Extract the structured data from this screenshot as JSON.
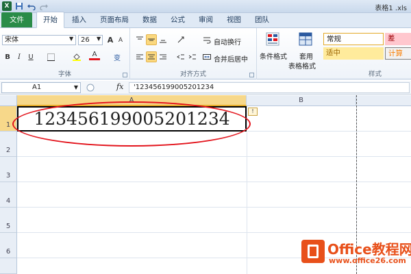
{
  "titlebar": {
    "doc_title": "表格1 .xls",
    "icons": [
      "excel-logo-icon",
      "save-icon",
      "undo-icon",
      "redo-icon"
    ]
  },
  "tabs": [
    "文件",
    "开始",
    "插入",
    "页面布局",
    "数据",
    "公式",
    "审阅",
    "视图",
    "团队"
  ],
  "ribbon": {
    "font": {
      "name": "宋体",
      "size": "26",
      "grow": "A",
      "shrink": "A",
      "bold": "B",
      "italic": "I",
      "underline": "U",
      "font_color": "A",
      "phonetic": "变",
      "label": "字体"
    },
    "alignment": {
      "wrap_text": "自动换行",
      "merge_center": "合并后居中",
      "label": "对齐方式"
    },
    "styles": {
      "conditional_format": "条件格式",
      "table_format_1": "套用",
      "table_format_2": "表格格式",
      "normal": "常规",
      "bad": "差",
      "neutral": "适中",
      "calc": "计算",
      "label": "样式"
    }
  },
  "formula_bar": {
    "name_box": "A1",
    "fx": "fx",
    "content": "'123456199005201234"
  },
  "grid": {
    "columns": [
      "A",
      "B"
    ],
    "rows": [
      "1",
      "2",
      "3",
      "4",
      "5",
      "6"
    ],
    "cell_a1": "123456199005201234",
    "warning_tag": "!"
  },
  "watermark": {
    "title": "Office教程网",
    "url": "www.office26.com"
  },
  "colors": {
    "file_tab": "#2a8c48",
    "selection": "#f7d88a",
    "annotation_ellipse": "#e3141c",
    "watermark": "#e8501a"
  }
}
